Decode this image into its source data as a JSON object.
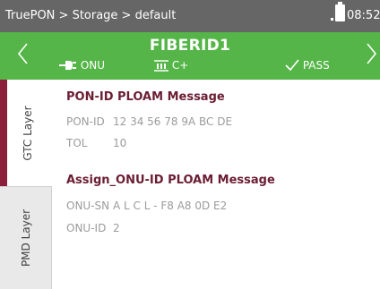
{
  "statusbar": {
    "breadcrumb": "TruePON > Storage > default",
    "time": "08:52"
  },
  "header": {
    "title": "FIBERID1",
    "onu_label": "ONU",
    "signal_label": "C+",
    "pass_label": "PASS"
  },
  "sidebar": {
    "tabs": [
      {
        "label": "GTC Layer",
        "active": true
      },
      {
        "label": "PMD Layer",
        "active": false
      }
    ]
  },
  "sections": [
    {
      "title": "PON-ID PLOAM Message",
      "rows": [
        {
          "label": "PON-ID",
          "value": "12 34  56 78  9A  BC  DE"
        },
        {
          "label": "TOL",
          "value": "10"
        }
      ]
    },
    {
      "title": "Assign_ONU-ID PLOAM Message",
      "rows": [
        {
          "label": "ONU-SN",
          "value": "A L C L - F8  A8  0D  E2"
        },
        {
          "label": "ONU-ID",
          "value": "2"
        }
      ]
    }
  ],
  "colors": {
    "statusbar": "#666666",
    "header": "#55b548",
    "accent": "#8c1f3c",
    "section_title": "#6b1d33",
    "field_text": "#9b9b9b"
  }
}
